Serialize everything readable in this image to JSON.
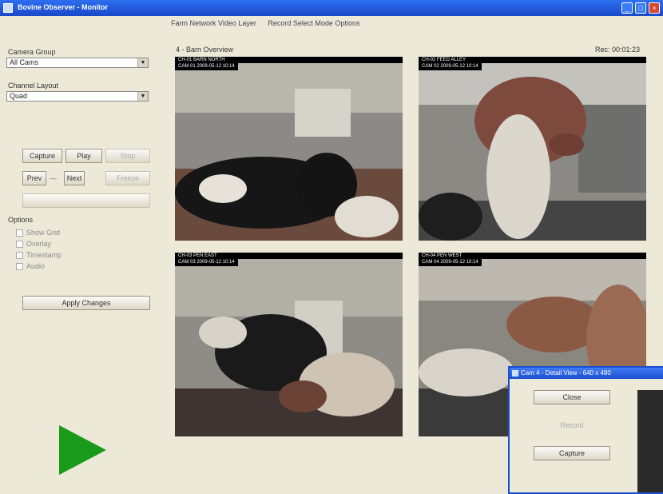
{
  "window": {
    "title": "Bovine Observer - Monitor",
    "minimize": "_",
    "maximize": "□",
    "close": "×"
  },
  "menu": {
    "items": [
      "Farm Network Video Layer",
      "Record Select Mode Options"
    ]
  },
  "sidebar": {
    "camera_group_label": "Camera Group",
    "camera_group_value": "All Cams",
    "channel_layout_label": "Channel Layout",
    "channel_layout_value": "Quad",
    "row1_buttons": [
      "Capture",
      "Play",
      "Stop"
    ],
    "row2_left": "Prev",
    "row2_mid": "Next",
    "row2_right": "Freeze",
    "options_label": "Options",
    "options": [
      "Show Grid",
      "Overlay",
      "Timestamp",
      "Audio"
    ],
    "apply_button": "Apply Changes"
  },
  "panel": {
    "title": "4 - Barn Overview",
    "right_info": "Rec: 00:01:23"
  },
  "cameras": [
    {
      "label": "CH-01 BARN NORTH",
      "stamp": "CAM 01  2009-05-12 10:14"
    },
    {
      "label": "CH-02 FEED ALLEY",
      "stamp": "CAM 02  2009-05-12 10:14"
    },
    {
      "label": "CH-03 PEN EAST",
      "stamp": "CAM 03  2009-05-12 10:14"
    },
    {
      "label": "CH-04 PEN WEST",
      "stamp": "CAM 04  2009-05-12 10:14"
    }
  ],
  "dialog": {
    "title": "Cam 4 - Detail View - 640 x 480",
    "ok": "Close",
    "mid": "Record",
    "cancel": "Capture"
  },
  "colors": {
    "titlebar": "#1c4ed0",
    "play": "#1a9a1a",
    "background": "#ece9d8"
  }
}
